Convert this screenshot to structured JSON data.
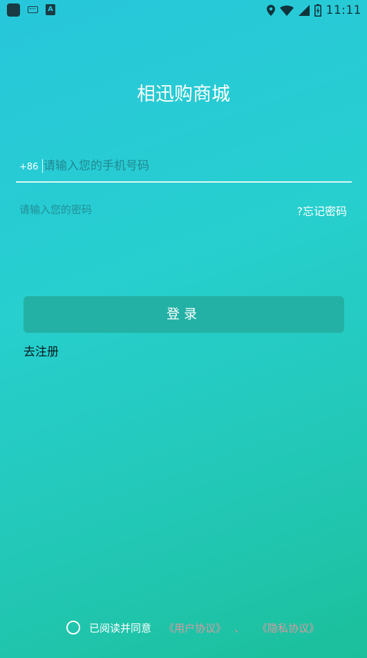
{
  "status_bar": {
    "time": "11:11",
    "keyboard_icon": "keyboard-icon",
    "a_icon_letter": "A",
    "icons": [
      "location-icon",
      "wifi-icon",
      "signal-icon",
      "battery-icon"
    ]
  },
  "app": {
    "title": "相迅购商城"
  },
  "login_form": {
    "country_code": "+86",
    "phone_placeholder": "请输入您的手机号码",
    "phone_value": "",
    "password_placeholder": "请输入您的密码",
    "password_value": "",
    "forgot_password_label": "?忘记密码",
    "login_button_label": "登录",
    "register_label": "去注册"
  },
  "agreement": {
    "checked": false,
    "text": "已阅读并同意",
    "user_agreement_label": "《用户协议》",
    "separator": "、",
    "privacy_policy_label": "《隐私协议》",
    "link_color": "#d89aa0"
  },
  "theme": {
    "gradient_start": "#27c6db",
    "gradient_end": "#1bbf9b",
    "button_color": "#24b1a5"
  }
}
